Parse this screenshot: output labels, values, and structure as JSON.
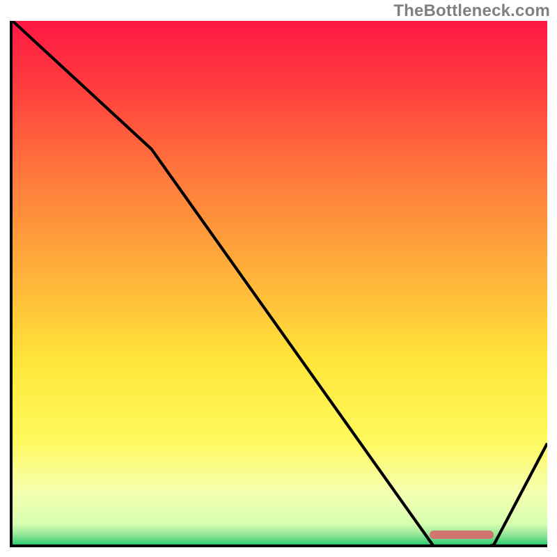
{
  "watermark": "TheBottleneck.com",
  "chart_data": {
    "type": "line",
    "title": "",
    "xlabel": "",
    "ylabel": "",
    "xlim": [
      0,
      100
    ],
    "ylim": [
      0,
      100
    ],
    "x": [
      0,
      26,
      80,
      82,
      90,
      100
    ],
    "values": [
      100,
      76,
      0,
      0,
      2,
      21
    ],
    "optimum_band": {
      "x_start": 78,
      "x_end": 90,
      "y": 1
    },
    "note": "Values estimated from pixel positions; y=0 is bottom axis, y=100 is top."
  },
  "gradient_stops": [
    {
      "pct": 0,
      "color": "#ff1744"
    },
    {
      "pct": 12,
      "color": "#ff3b3e"
    },
    {
      "pct": 30,
      "color": "#ff7a3c"
    },
    {
      "pct": 50,
      "color": "#ffb63a"
    },
    {
      "pct": 65,
      "color": "#ffe63a"
    },
    {
      "pct": 80,
      "color": "#fff95c"
    },
    {
      "pct": 90,
      "color": "#f6ffb0"
    },
    {
      "pct": 96,
      "color": "#d6ffb0"
    },
    {
      "pct": 98,
      "color": "#9be89b"
    },
    {
      "pct": 100,
      "color": "#2ecc71"
    }
  ],
  "band_color": "#d0746f",
  "curve_color": "#000000"
}
